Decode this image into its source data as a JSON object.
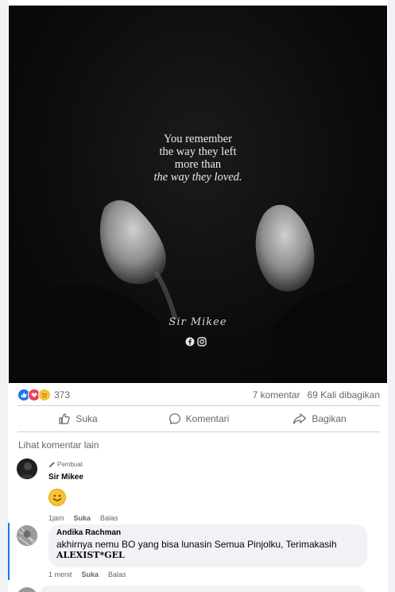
{
  "post": {
    "quote_lines": [
      "You remember",
      "the way they left",
      "more than",
      "the way they loved."
    ],
    "signature": "Sir Mikee",
    "reaction_count": "373",
    "comments_count": "7 komentar",
    "shares_count": "69 Kali dibagikan"
  },
  "actions": {
    "like": "Suka",
    "comment": "Komentari",
    "share": "Bagikan"
  },
  "more_comments_label": "Lihat komentar lain",
  "comments": [
    {
      "author_badge": "Pembuat",
      "name": "Sir Mikee",
      "time": "1jam",
      "like": "Suka",
      "reply": "Balas"
    },
    {
      "name": "Andika Rachman",
      "text": "akhirnya nemu BO yang bisa lunasin Semua Pinjolku, Terimakasih",
      "text_bold": "ALEXIST*GEL",
      "time": "1 menit",
      "like": "Suka",
      "reply": "Balas"
    }
  ],
  "colors": {
    "accent": "#1877f2",
    "like_blue": "#1877f2",
    "love_red": "#f33e58",
    "sad_yellow": "#f7c236"
  },
  "icons": [
    "like-reaction-icon",
    "love-reaction-icon",
    "sad-reaction-icon",
    "thumbs-up-icon",
    "comment-icon",
    "share-icon",
    "facebook-icon",
    "instagram-icon",
    "pencil-icon",
    "smile-emoji-icon"
  ]
}
